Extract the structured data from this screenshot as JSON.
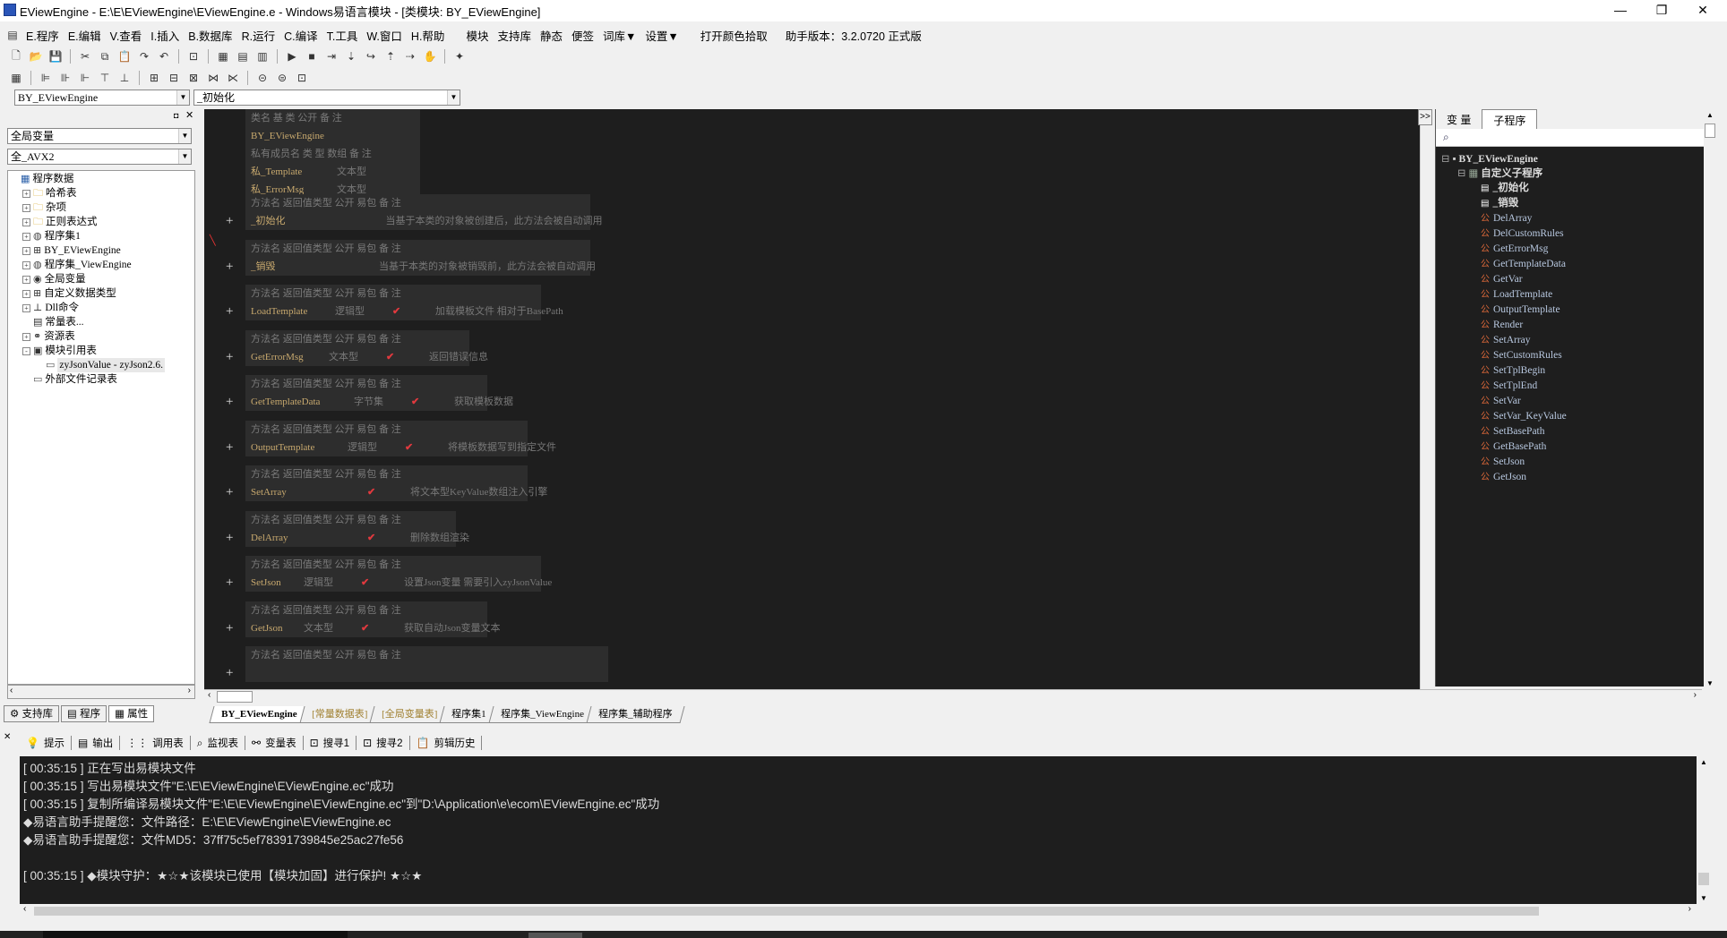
{
  "window": {
    "title": "EViewEngine - E:\\E\\EViewEngine\\EViewEngine.e - Windows易语言模块 - [类模块: BY_EViewEngine]",
    "min": "—",
    "max": "❐",
    "close": "✕"
  },
  "menu": [
    "E.程序",
    "E.编辑",
    "V.查看",
    "I.插入",
    "B.数据库",
    "R.运行",
    "C.编译",
    "T.工具",
    "W.窗口",
    "H.帮助",
    "模块",
    "支持库",
    "静态",
    "便签",
    "词库▼",
    "设置▼",
    "打开颜色拾取",
    "助手版本：3.2.0720 正式版"
  ],
  "combos": {
    "class": "BY_EViewEngine",
    "method": "_初始化",
    "scope": "全局变量",
    "lib": "全_AVX2"
  },
  "left_tree": [
    {
      "label": "程序数据",
      "level": 0,
      "expand": "",
      "icon": "grid"
    },
    {
      "label": "哈希表",
      "level": 1,
      "expand": "+",
      "icon": "folder"
    },
    {
      "label": "杂项",
      "level": 1,
      "expand": "+",
      "icon": "folder"
    },
    {
      "label": "正则表达式",
      "level": 1,
      "expand": "+",
      "icon": "folder"
    },
    {
      "label": "程序集1",
      "level": 1,
      "expand": "+",
      "icon": "globe"
    },
    {
      "label": "BY_EViewEngine",
      "level": 1,
      "expand": "+",
      "icon": "cls"
    },
    {
      "label": "程序集_ViewEngine",
      "level": 1,
      "expand": "+",
      "icon": "globe"
    },
    {
      "label": "全局变量",
      "level": 1,
      "expand": "+",
      "icon": "var"
    },
    {
      "label": "自定义数据类型",
      "level": 1,
      "expand": "+",
      "icon": "cls"
    },
    {
      "label": "Dll命令",
      "level": 1,
      "expand": "+",
      "icon": "dll"
    },
    {
      "label": "常量表...",
      "level": 1,
      "expand": "",
      "icon": "tbl"
    },
    {
      "label": "资源表",
      "level": 1,
      "expand": "+",
      "icon": "res"
    },
    {
      "label": "模块引用表",
      "level": 1,
      "expand": "-",
      "icon": "mod"
    },
    {
      "label": "zyJsonValue - zyJson2.6.",
      "level": 2,
      "expand": "",
      "icon": "doc"
    },
    {
      "label": "外部文件记录表",
      "level": 1,
      "expand": "",
      "icon": "doc"
    }
  ],
  "left_tabs": [
    "支持库",
    "程序",
    "属性"
  ],
  "class_table": {
    "header": "类名         基 类      公开    备 注",
    "name": "BY_EViewEngine",
    "member_header": "私有成员名        类 型      数组    备 注",
    "members": [
      {
        "name": "私_Template",
        "type": "文本型"
      },
      {
        "name": "私_ErrorMsg",
        "type": "文本型"
      }
    ]
  },
  "methods": [
    {
      "name": "_初始化",
      "ret": "",
      "pub": "",
      "note": "当基于本类的对象被创建后，此方法会被自动调用",
      "header": "方法名   返回值类型   公开   易包   备 注"
    },
    {
      "name": "_销毁",
      "ret": "",
      "pub": "",
      "note": "当基于本类的对象被销毁前，此方法会被自动调用",
      "header": "方法名   返回值类型   公开   易包   备 注"
    },
    {
      "name": "LoadTemplate",
      "ret": "逻辑型",
      "pub": "✔",
      "note": "加载模板文件 相对于BasePath",
      "header": "方法名           返回值类型   公开   易包   备 注"
    },
    {
      "name": "GetErrorMsg",
      "ret": "文本型",
      "pub": "✔",
      "note": "返回错误信息",
      "header": "方法名          返回值类型   公开   易包   备 注"
    },
    {
      "name": "GetTemplateData",
      "ret": "字节集",
      "pub": "✔",
      "note": "获取模板数据",
      "header": "方法名             返回值类型   公开   易包   备 注"
    },
    {
      "name": "OutputTemplate",
      "ret": "逻辑型",
      "pub": "✔",
      "note": "将模板数据写到指定文件",
      "header": "方法名            返回值类型   公开   易包   备 注"
    },
    {
      "name": "SetArray",
      "ret": "",
      "pub": "✔",
      "note": "将文本型KeyValue数组注入引擎",
      "header": "方法名       返回值类型   公开   易包   备 注"
    },
    {
      "name": "DelArray",
      "ret": "",
      "pub": "✔",
      "note": "删除数组渲染",
      "header": "方法名       返回值类型   公开   易包   备 注"
    },
    {
      "name": "SetJson",
      "ret": "逻辑型",
      "pub": "✔",
      "note": "设置Json变量 需要引入zyJsonValue",
      "header": "方法名     返回值类型   公开   易包   备 注"
    },
    {
      "name": "GetJson",
      "ret": "文本型",
      "pub": "✔",
      "note": "获取自动Json变量文本",
      "header": "方法名     返回值类型   公开   易包   备 注"
    },
    {
      "name": "",
      "ret": "",
      "pub": "",
      "note": "",
      "header": "方法名             返回值类型   公开   易包   备 注"
    }
  ],
  "right_panel": {
    "tab_vars": "变 量",
    "tab_subs": "子程序",
    "collapse": ">>",
    "root": "BY_EViewEngine",
    "group": "自定义子程序",
    "items": [
      "_初始化",
      "_销毁",
      "DelArray",
      "DelCustomRules",
      "GetErrorMsg",
      "GetTemplateData",
      "GetVar",
      "LoadTemplate",
      "OutputTemplate",
      "Render",
      "SetArray",
      "SetCustomRules",
      "SetTplBegin",
      "SetTplEnd",
      "SetVar",
      "SetVar_KeyValue",
      "SetBasePath",
      "GetBasePath",
      "SetJson",
      "GetJson"
    ]
  },
  "bottom_tabs": [
    "BY_EViewEngine",
    "[常量数据表]",
    "[全局变量表]",
    "程序集1",
    "程序集_ViewEngine",
    "程序集_辅助程序"
  ],
  "output_tabs": [
    "提示",
    "输出",
    "调用表",
    "监视表",
    "变量表",
    "搜寻1",
    "搜寻2",
    "剪辑历史"
  ],
  "output_lines": [
    "[ 00:35:15 ] 正在写出易模块文件",
    "[ 00:35:15 ] 写出易模块文件\"E:\\E\\EViewEngine\\EViewEngine.ec\"成功",
    "[ 00:35:15 ] 复制所编译易模块文件\"E:\\E\\EViewEngine\\EViewEngine.ec\"到\"D:\\Application\\e\\ecom\\EViewEngine.ec\"成功",
    "◆易语言助手提醒您：文件路径：E:\\E\\EViewEngine\\EViewEngine.ec",
    "◆易语言助手提醒您：文件MD5：37ff75c5ef78391739845e25ac27fe56",
    "",
    "[ 00:35:15 ] ◆模块守护：★☆★该模块已使用【模块加固】进行保护! ★☆★"
  ],
  "colors": {
    "editor_bg": "#1e1e1e",
    "block_bg": "#2d2d2d",
    "accent_name": "#c8a96e",
    "check": "#e0393e"
  }
}
